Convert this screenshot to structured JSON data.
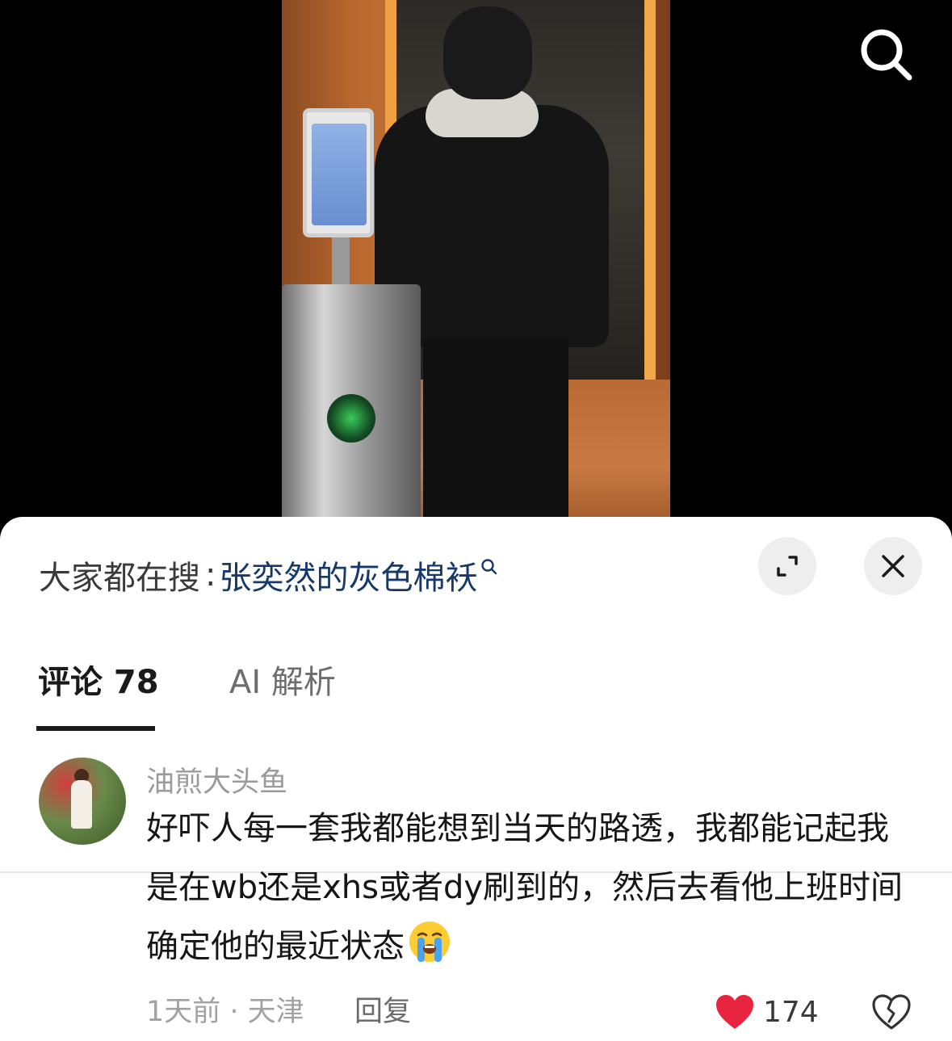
{
  "video": {
    "search_icon": "search-icon"
  },
  "sheet": {
    "search_prefix": "大家都在搜",
    "search_colon": ":",
    "search_term": "张奕然的灰色棉袄",
    "search_mini_icon": "search-icon",
    "expand_icon": "expand-icon",
    "close_icon": "close-icon"
  },
  "tabs": [
    {
      "label": "评论 78",
      "active": true
    },
    {
      "label": "AI 解析",
      "active": false
    }
  ],
  "comment": {
    "username": "油煎大头鱼",
    "text": "好吓人每一套我都能想到当天的路透，我都能记起我是在wb还是xhs或者dy刷到的，然后去看他上班时间确定他的最近状态",
    "emoji": "loudly-crying-face",
    "time_location": "1天前 · 天津",
    "reply_label": "回复",
    "like_count": "174",
    "liked": true,
    "like_icon": "heart-icon",
    "dislike_icon": "broken-heart-icon"
  },
  "colors": {
    "search_term": "#16386b",
    "like_red": "#e8243f",
    "sheet_bg": "#ffffff"
  }
}
